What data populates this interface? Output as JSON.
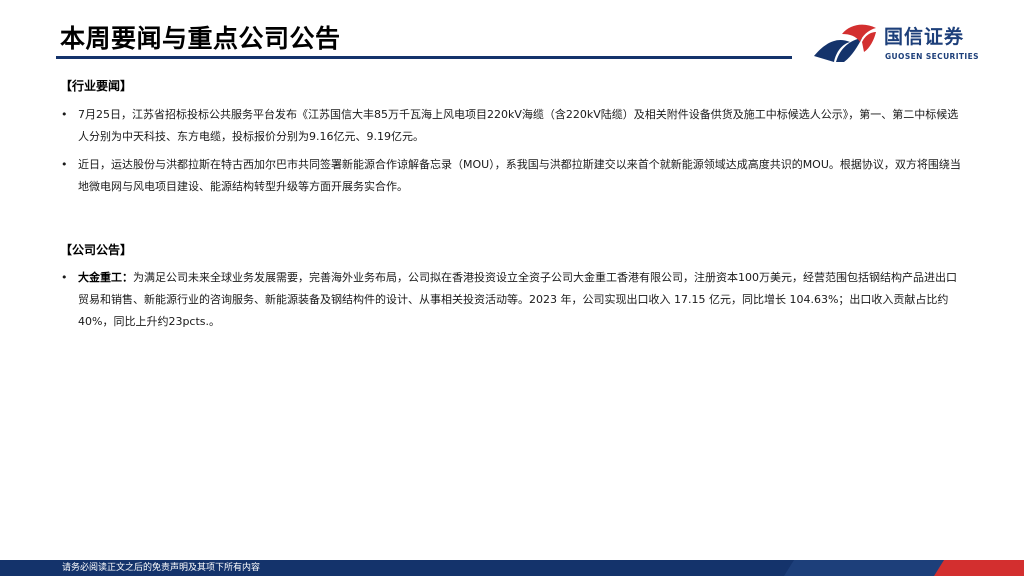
{
  "header": {
    "title": "本周要闻与重点公司公告",
    "logo": {
      "name_cn": "国信证券",
      "name_en": "GUOSEN SECURITIES",
      "icon": "guosen-logo-icon",
      "colors": {
        "red": "#d32f2f",
        "navy": "#14336b"
      }
    }
  },
  "sections": {
    "industry": {
      "heading": "【行业要闻】",
      "items": [
        {
          "text": "7月25日，江苏省招标投标公共服务平台发布《江苏国信大丰85万千瓦海上风电项目220kV海缆（含220kV陆缆）及相关附件设备供货及施工中标候选人公示》，第一、第二中标候选人分别为中天科技、东方电缆，投标报价分别为9.16亿元、9.19亿元。"
        },
        {
          "text": "近日，运达股份与洪都拉斯在特古西加尔巴市共同签署新能源合作谅解备忘录（MOU），系我国与洪都拉斯建交以来首个就新能源领域达成高度共识的MOU。根据协议，双方将围绕当地微电网与风电项目建设、能源结构转型升级等方面开展务实合作。"
        }
      ]
    },
    "company": {
      "heading": "【公司公告】",
      "items": [
        {
          "lead": "大金重工：",
          "text": "为满足公司未来全球业务发展需要，完善海外业务布局，公司拟在香港投资设立全资子公司大金重工香港有限公司，注册资本100万美元，经营范围包括钢结构产品进出口贸易和销售、新能源行业的咨询服务、新能源装备及钢结构件的设计、从事相关投资活动等。2023 年，公司实现出口收入 17.15 亿元，同比增长 104.63%；出口收入贡献占比约 40%，同比上升约23pcts.。"
        }
      ]
    }
  },
  "footer": {
    "disclaimer": "请务必阅读正文之后的免责声明及其项下所有内容"
  },
  "bullet_char": "•"
}
